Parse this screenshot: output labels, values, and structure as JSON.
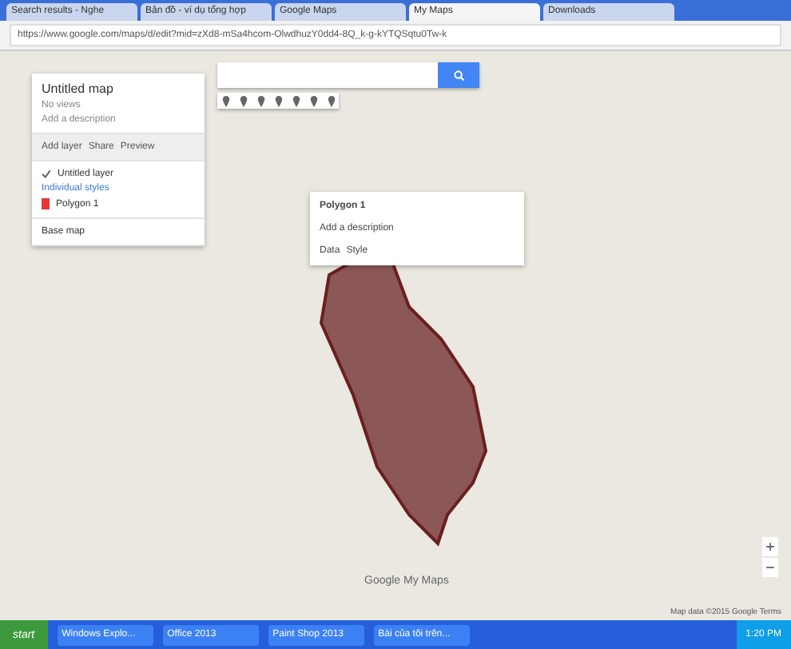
{
  "browser": {
    "tabs": [
      {
        "label": "Search results - Nghe",
        "selected": false
      },
      {
        "label": "Bản đồ - ví dụ tổng hợp",
        "selected": false
      },
      {
        "label": "Google Maps",
        "selected": false
      },
      {
        "label": "My Maps",
        "selected": true
      },
      {
        "label": "Downloads",
        "selected": false
      }
    ],
    "url": "https://www.google.com/maps/d/edit?mid=zXd8-mSa4hcom-OlwdhuzY0dd4-8Q_k-g-kYTQSqtu0Tw-k"
  },
  "map_panel": {
    "title": "Untitled map",
    "subtitle": "No views",
    "description": "Add a description",
    "actions": [
      "Add layer",
      "Share",
      "Preview"
    ],
    "layer": {
      "name": "Untitled layer",
      "checked": true,
      "style_link": "Individual styles",
      "items": [
        {
          "name": "Polygon 1",
          "color": "#e53935"
        }
      ]
    },
    "base_map": "Base map"
  },
  "popup": {
    "title": "Polygon 1",
    "description": "Add a description",
    "footer": [
      "Data",
      "Style"
    ]
  },
  "brand": "Google My Maps",
  "attribution": "Map data ©2015 Google  Terms",
  "taskbar": {
    "start": "start",
    "windows": [
      "Windows Explo...",
      "Office 2013",
      "Paint Shop 2013",
      "Bài của tôi trên..."
    ],
    "clock": "1:20 PM"
  }
}
